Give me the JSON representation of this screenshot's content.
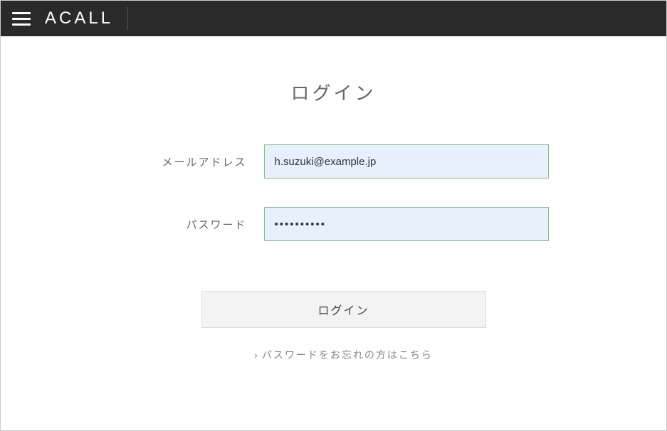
{
  "header": {
    "logo_text": "ACALL"
  },
  "login": {
    "title": "ログイン",
    "email_label": "メールアドレス",
    "email_value": "h.suzuki@example.jp",
    "password_label": "パスワード",
    "password_value": "••••••••••",
    "submit_label": "ログイン",
    "forgot_password_label": "パスワードをお忘れの方はこちら"
  }
}
